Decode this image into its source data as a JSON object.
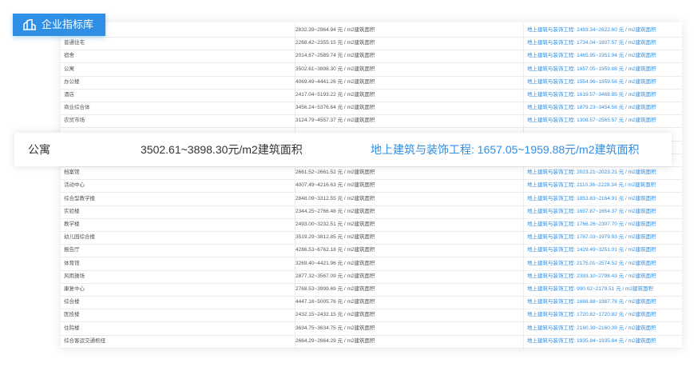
{
  "badge": {
    "label": "企业指标库"
  },
  "highlight": {
    "name": "公寓",
    "range": "3502.61~3898.30元/m2建筑面积",
    "detail": "地上建筑与装饰工程: 1657.05~1959.88元/m2建筑面积"
  },
  "rows": [
    {
      "name": "",
      "range": "2832.39~2964.94 元 / m2建筑面积",
      "detail": "地上建筑与装饰工程: 2493.34~2622.60 元 / m2建筑面积"
    },
    {
      "name": "普通住宅",
      "range": "2268.42~2355.15 元 / m2建筑面积",
      "detail": "地上建筑与装饰工程: 1734.04~1807.57 元 / m2建筑面积"
    },
    {
      "name": "宿舍",
      "range": "2014.67~2589.74 元 / m2建筑面积",
      "detail": "地上建筑与装饰工程: 1465.95~1951.94 元 / m2建筑面积"
    },
    {
      "name": "公寓",
      "range": "3502.61~3898.30 元 / m2建筑面积",
      "detail": "地上建筑与装饰工程: 1657.05~1959.88 元 / m2建筑面积"
    },
    {
      "name": "办公楼",
      "range": "4069.49~4441.26 元 / m2建筑面积",
      "detail": "地上建筑与装饰工程: 1554.96~1859.56 元 / m2建筑面积"
    },
    {
      "name": "酒店",
      "range": "2417.04~5193.22 元 / m2建筑面积",
      "detail": "地上建筑与装饰工程: 1619.57~3468.85 元 / m2建筑面积"
    },
    {
      "name": "商业综合体",
      "range": "3456.24~5376.64 元 / m2建筑面积",
      "detail": "地上建筑与装饰工程: 1879.23~3454.56 元 / m2建筑面积"
    },
    {
      "name": "农贸市场",
      "range": "3124.79~4557.37 元 / m2建筑面积",
      "detail": "地上建筑与装饰工程: 1308.57~2565.57 元 / m2建筑面积"
    },
    {
      "name": "",
      "range": "",
      "detail": ""
    },
    {
      "name": "",
      "range": "",
      "detail": ""
    },
    {
      "name": "",
      "range": "",
      "detail": ""
    },
    {
      "name": "档案馆",
      "range": "2661.52~2661.52 元 / m2建筑面积",
      "detail": "地上建筑与装饰工程: 2023.21~2023.21 元 / m2建筑面积"
    },
    {
      "name": "活动中心",
      "range": "4007.49~4216.63 元 / m2建筑面积",
      "detail": "地上建筑与装饰工程: 2110.36~2229.34 元 / m2建筑面积"
    },
    {
      "name": "综合型教学楼",
      "range": "2848.09~3312.55 元 / m2建筑面积",
      "detail": "地上建筑与装饰工程: 1853.83~2164.91 元 / m2建筑面积"
    },
    {
      "name": "实验楼",
      "range": "2344.25~2766.48 元 / m2建筑面积",
      "detail": "地上建筑与装饰工程: 1657.87~1654.37 元 / m2建筑面积"
    },
    {
      "name": "教学楼",
      "range": "2493.00~3232.51 元 / m2建筑面积",
      "detail": "地上建筑与装饰工程: 1766.26~2307.70 元 / m2建筑面积"
    },
    {
      "name": "幼儿园综合楼",
      "range": "3519.29~3812.85 元 / m2建筑面积",
      "detail": "地上建筑与装饰工程: 1787.03~1979.93 元 / m2建筑面积"
    },
    {
      "name": "报告厅",
      "range": "4286.53~6762.18 元 / m2建筑面积",
      "detail": "地上建筑与装饰工程: 1429.49~3251.01 元 / m2建筑面积"
    },
    {
      "name": "体育馆",
      "range": "3269.40~4421.96 元 / m2建筑面积",
      "detail": "地上建筑与装饰工程: 2175.01~2574.52 元 / m2建筑面积"
    },
    {
      "name": "风雨操场",
      "range": "2877.32~3567.09 元 / m2建筑面积",
      "detail": "地上建筑与装饰工程: 2393.10~2798.43 元 / m2建筑面积"
    },
    {
      "name": "康复中心",
      "range": "2768.53~3999.69 元 / m2建筑面积",
      "detail": "地上建筑与装饰工程: 990.02~2179.51 元 / m2建筑面积"
    },
    {
      "name": "综合楼",
      "range": "4447.16~5005.76 元 / m2建筑面积",
      "detail": "地上建筑与装饰工程: 1666.68~1987.78 元 / m2建筑面积"
    },
    {
      "name": "医技楼",
      "range": "2432.15~2432.15 元 / m2建筑面积",
      "detail": "地上建筑与装饰工程: 1720.82~1720.82 元 / m2建筑面积"
    },
    {
      "name": "住院楼",
      "range": "3634.75~3634.75 元 / m2建筑面积",
      "detail": "地上建筑与装饰工程: 2160.39~2160.39 元 / m2建筑面积"
    },
    {
      "name": "综合客运交通枢纽",
      "range": "2664.29~2664.29 元 / m2建筑面积",
      "detail": "地上建筑与装饰工程: 1935.84~1935.84 元 / m2建筑面积"
    }
  ]
}
